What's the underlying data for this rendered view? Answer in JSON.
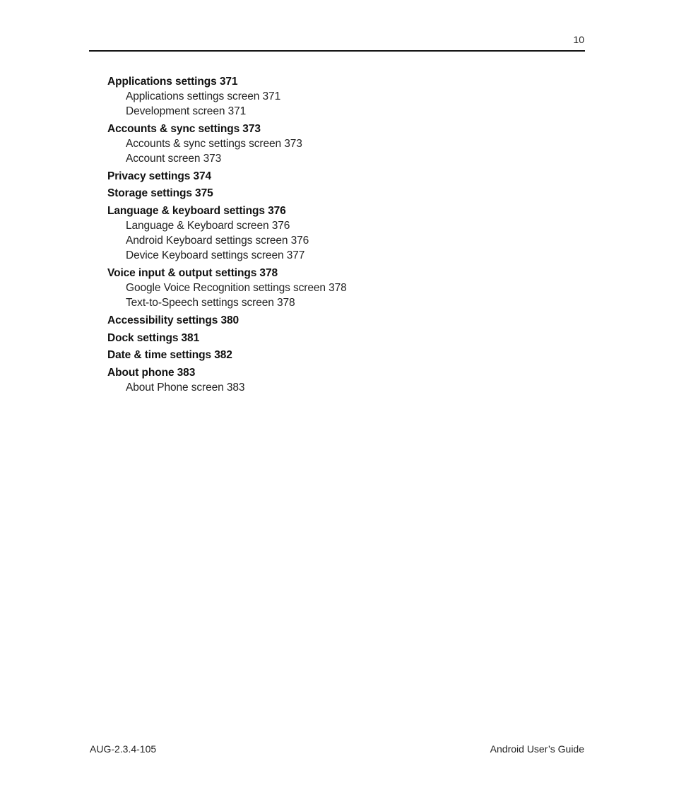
{
  "header": {
    "page_number": "10"
  },
  "toc": [
    {
      "title": "Applications settings 371",
      "subitems": [
        "Applications settings screen 371",
        "Development screen 371"
      ]
    },
    {
      "title": "Accounts & sync settings 373",
      "subitems": [
        "Accounts & sync settings screen 373",
        "Account screen 373"
      ]
    },
    {
      "title": "Privacy settings 374",
      "subitems": []
    },
    {
      "title": "Storage settings 375",
      "subitems": []
    },
    {
      "title": "Language & keyboard settings 376",
      "subitems": [
        "Language & Keyboard screen 376",
        "Android Keyboard settings screen 376",
        "Device Keyboard settings screen 377"
      ]
    },
    {
      "title": "Voice input & output settings 378",
      "subitems": [
        "Google Voice Recognition settings screen 378",
        "Text-to-Speech settings screen 378"
      ]
    },
    {
      "title": "Accessibility settings 380",
      "subitems": []
    },
    {
      "title": "Dock settings 381",
      "subitems": []
    },
    {
      "title": "Date & time settings 382",
      "subitems": []
    },
    {
      "title": "About phone 383",
      "subitems": [
        "About Phone screen 383"
      ]
    }
  ],
  "footer": {
    "doc_id": "AUG-2.3.4-105",
    "doc_title": "Android User’s Guide"
  }
}
